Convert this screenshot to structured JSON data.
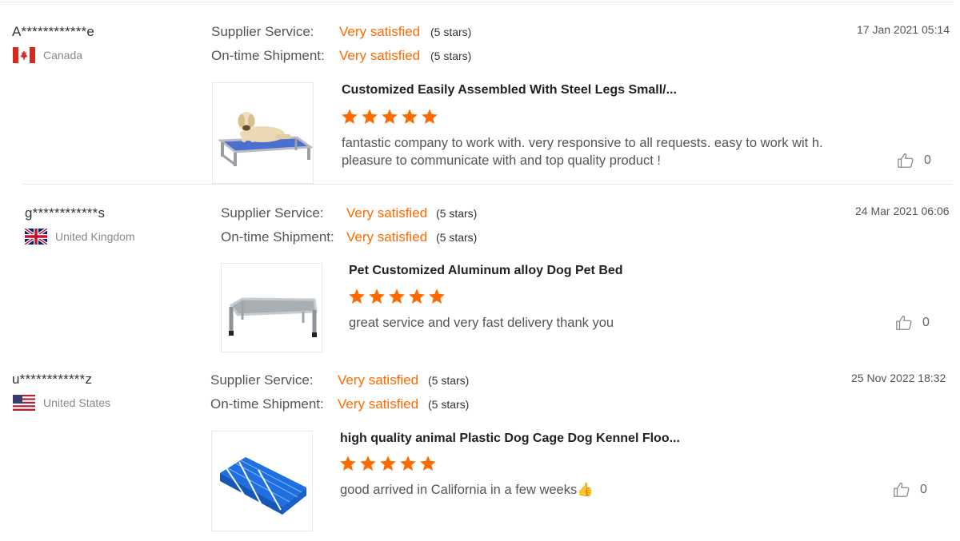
{
  "labels": {
    "supplier_service": "Supplier Service:",
    "ontime_shipment": "On-time Shipment:"
  },
  "colors": {
    "accent": "#ff6a00",
    "star": "#ff6a00"
  },
  "reviews": [
    {
      "username": "A************e",
      "country": "Canada",
      "flag_icon": "canada-flag-icon",
      "date": "17 Jan 2021 05:14",
      "supplier_rating": "Very satisfied",
      "supplier_stars": "(5 stars)",
      "shipment_rating": "Very satisfied",
      "shipment_stars": "(5 stars)",
      "product_title": "Customized Easily Assembled With Steel Legs Small/...",
      "product_image": "dog-on-blue-cot-image",
      "rating": 5,
      "comment": "fantastic company to work with. very responsive to all requests. easy to work wit h.  pleasure to communicate with and top quality product !",
      "likes": "0"
    },
    {
      "username": "g************s",
      "country": "United Kingdom",
      "flag_icon": "uk-flag-icon",
      "date": "24 Mar 2021 06:06",
      "supplier_rating": "Very satisfied",
      "supplier_stars": "(5 stars)",
      "shipment_rating": "Very satisfied",
      "shipment_stars": "(5 stars)",
      "product_title": "Pet Customized Aluminum alloy Dog Pet Bed",
      "product_image": "grey-pet-bed-image",
      "rating": 5,
      "comment": "great service and very fast delivery thank you",
      "likes": "0"
    },
    {
      "username": "u************z",
      "country": "United States",
      "flag_icon": "us-flag-icon",
      "date": "25 Nov 2022 18:32",
      "supplier_rating": "Very satisfied",
      "supplier_stars": "(5 stars)",
      "shipment_rating": "Very satisfied",
      "shipment_stars": "(5 stars)",
      "product_title": "high quality animal Plastic Dog Cage Dog Kennel Floo...",
      "product_image": "blue-plastic-floor-image",
      "rating": 5,
      "comment": "good arrived in California in a few weeks👍",
      "likes": "0"
    }
  ]
}
